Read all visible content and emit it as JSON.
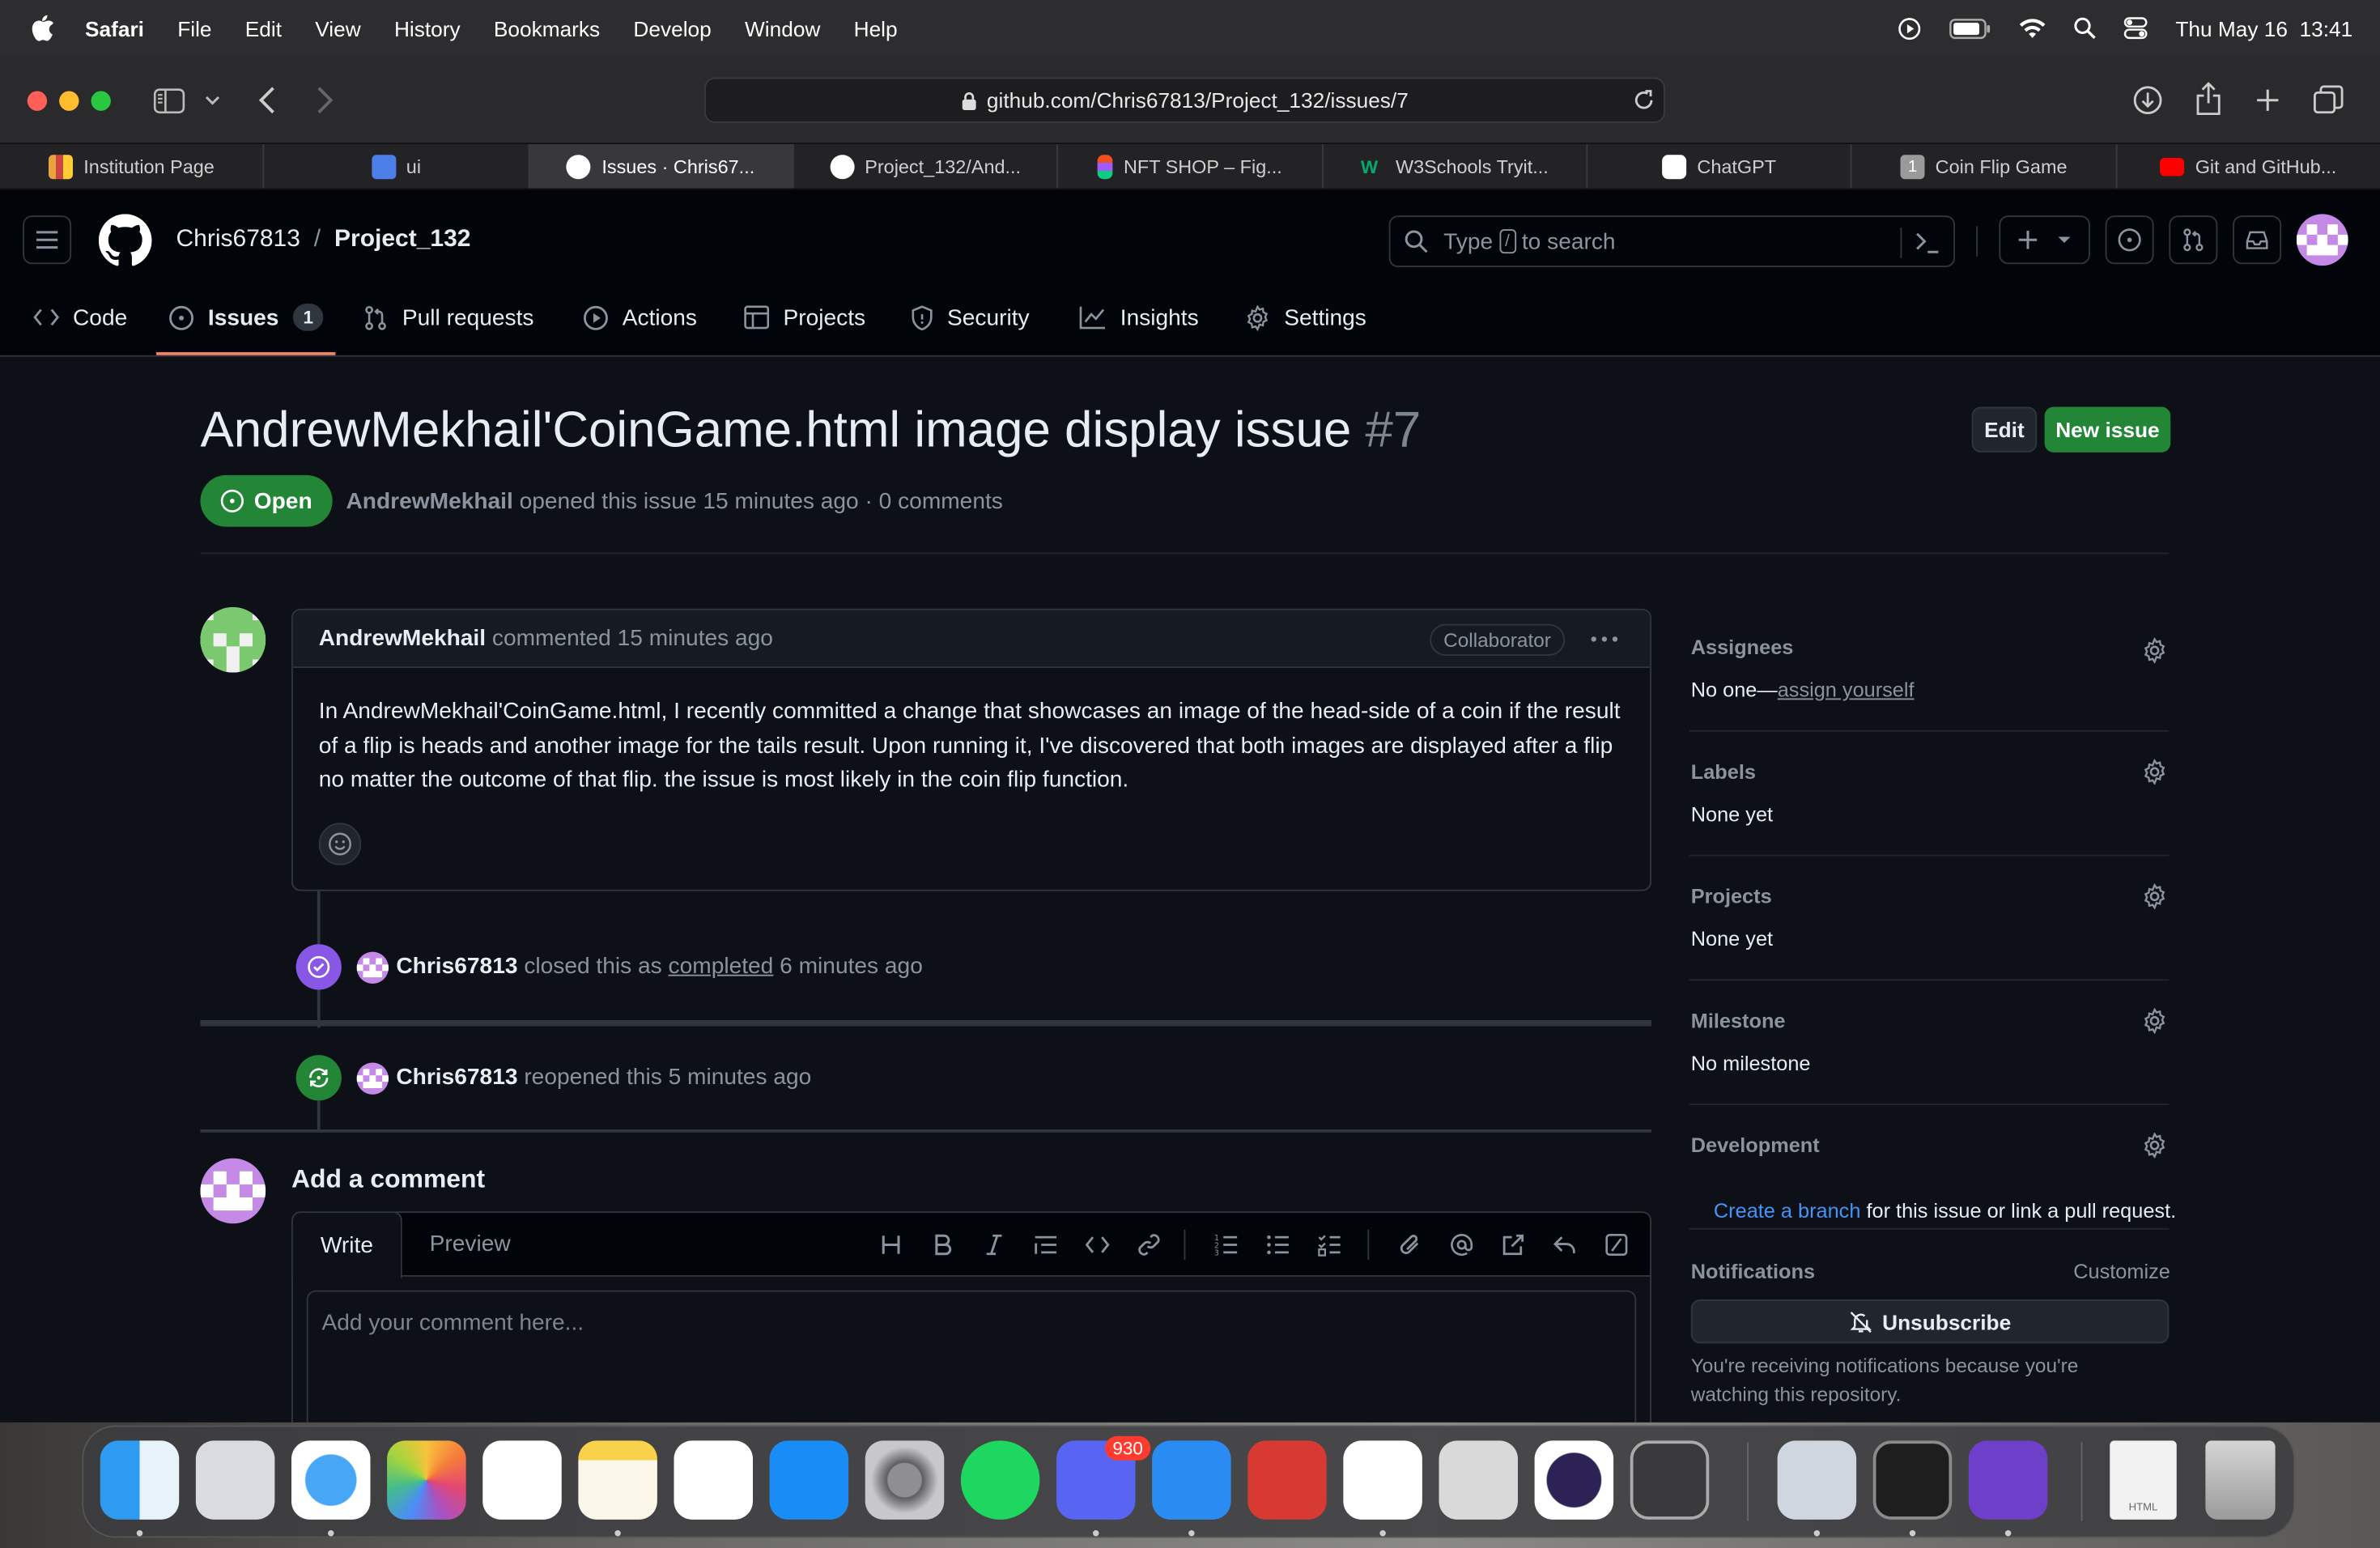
{
  "menubar": {
    "app": "Safari",
    "items": [
      "File",
      "Edit",
      "View",
      "History",
      "Bookmarks",
      "Develop",
      "Window",
      "Help"
    ],
    "clock": "Thu May 16  13:41"
  },
  "browser": {
    "url": "github.com/Chris67813/Project_132/issues/7",
    "tabs": [
      {
        "label": "Institution Page",
        "color": "#e8a33c"
      },
      {
        "label": "ui",
        "color": "#4c7ee8"
      },
      {
        "label": "Issues · Chris67...",
        "color": "#ffffff"
      },
      {
        "label": "Project_132/And...",
        "color": "#ffffff"
      },
      {
        "label": "NFT SHOP – Fig...",
        "color": "#f24e1e"
      },
      {
        "label": "W3Schools Tryit...",
        "color": "#04aa6d"
      },
      {
        "label": "ChatGPT",
        "color": "#ffffff"
      },
      {
        "label": "Coin Flip Game",
        "color": "#9a9a9a"
      },
      {
        "label": "Git and GitHub...",
        "color": "#ff0000"
      }
    ]
  },
  "github": {
    "owner": "Chris67813",
    "separator": "/",
    "repo": "Project_132",
    "search_prefix": "Type",
    "search_key": "/",
    "search_suffix": "to search",
    "nav": {
      "code": "Code",
      "issues": "Issues",
      "issues_count": "1",
      "pulls": "Pull requests",
      "actions": "Actions",
      "projects": "Projects",
      "security": "Security",
      "insights": "Insights",
      "settings": "Settings"
    }
  },
  "issue": {
    "title": "AndrewMekhail'CoinGame.html image display issue",
    "number": "#7",
    "edit_label": "Edit",
    "new_issue_label": "New issue",
    "state": "Open",
    "author": "AndrewMekhail",
    "meta": "opened this issue 15 minutes ago · 0 comments",
    "comment": {
      "author": "AndrewMekhail",
      "time": "commented 15 minutes ago",
      "role": "Collaborator",
      "body": "In AndrewMekhail'CoinGame.html, I recently committed a change that showcases an image of the head-side of a coin if the result of a flip is heads and another image for the tails result. Upon running it, I've discovered that both images are displayed after a flip no matter the outcome of that flip. the issue is most likely in the coin flip function."
    },
    "events": [
      {
        "actor": "Chris67813",
        "pre": "closed this as",
        "link": "completed",
        "post": "6 minutes ago"
      },
      {
        "actor": "Chris67813",
        "text": "reopened this 5 minutes ago"
      }
    ],
    "add_comment": {
      "heading": "Add a comment",
      "write_tab": "Write",
      "preview_tab": "Preview",
      "placeholder": "Add your comment here..."
    }
  },
  "sidebar": {
    "assignees_label": "Assignees",
    "assignees_value": "No one—",
    "assignees_link": "assign yourself",
    "labels_label": "Labels",
    "labels_value": "None yet",
    "projects_label": "Projects",
    "projects_value": "None yet",
    "milestone_label": "Milestone",
    "milestone_value": "No milestone",
    "development_label": "Development",
    "development_link": "Create a branch",
    "development_text": " for this issue or link a pull request.",
    "notifications_label": "Notifications",
    "customize_label": "Customize",
    "unsubscribe_label": "Unsubscribe",
    "notifications_note": "You're receiving notifications because you're watching this repository."
  },
  "dock": {
    "discord_badge": "930",
    "html_file_label": "HTML"
  }
}
